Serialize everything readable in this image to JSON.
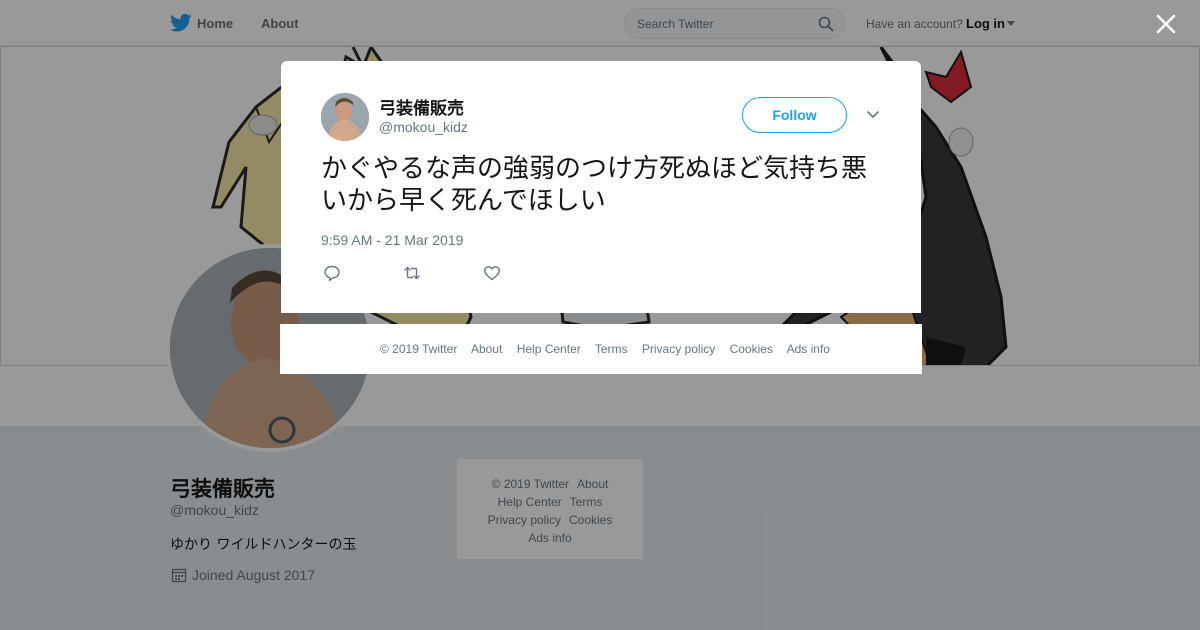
{
  "nav": {
    "home_label": "Home",
    "about_label": "About",
    "search_placeholder": "Search Twitter",
    "have_account": "Have an account?",
    "login_label": "Log in"
  },
  "profile": {
    "name": "弓装備販売",
    "handle": "@mokou_kidz",
    "bio": "ゆかり ワイルドハンターの玉",
    "joined": "Joined August 2017"
  },
  "side_footer": {
    "copyright": "© 2019 Twitter",
    "about": "About",
    "help_center": "Help Center",
    "terms": "Terms",
    "privacy": "Privacy policy",
    "cookies": "Cookies",
    "ads_info": "Ads info"
  },
  "tweet": {
    "name": "弓装備販売",
    "handle": "@mokou_kidz",
    "follow_label": "Follow",
    "text": "かぐやるな声の強弱のつけ方死ぬほど気持ち悪いから早く死んでほしい",
    "timestamp": "9:59 AM - 21 Mar 2019"
  },
  "modal_footer": {
    "copyright": "© 2019 Twitter",
    "about": "About",
    "help_center": "Help Center",
    "terms": "Terms",
    "privacy": "Privacy policy",
    "cookies": "Cookies",
    "ads_info": "Ads info"
  },
  "colors": {
    "brand": "#1da1f2",
    "overlay": "rgba(0,0,0,0.40)",
    "muted_text": "#657786"
  },
  "icons": {
    "logo": "twitter-bird-icon",
    "search": "search-icon",
    "close": "close-icon",
    "calendar": "calendar-icon",
    "reply": "reply-icon",
    "retweet": "retweet-icon",
    "like": "heart-icon",
    "caret": "chevron-down-icon"
  }
}
